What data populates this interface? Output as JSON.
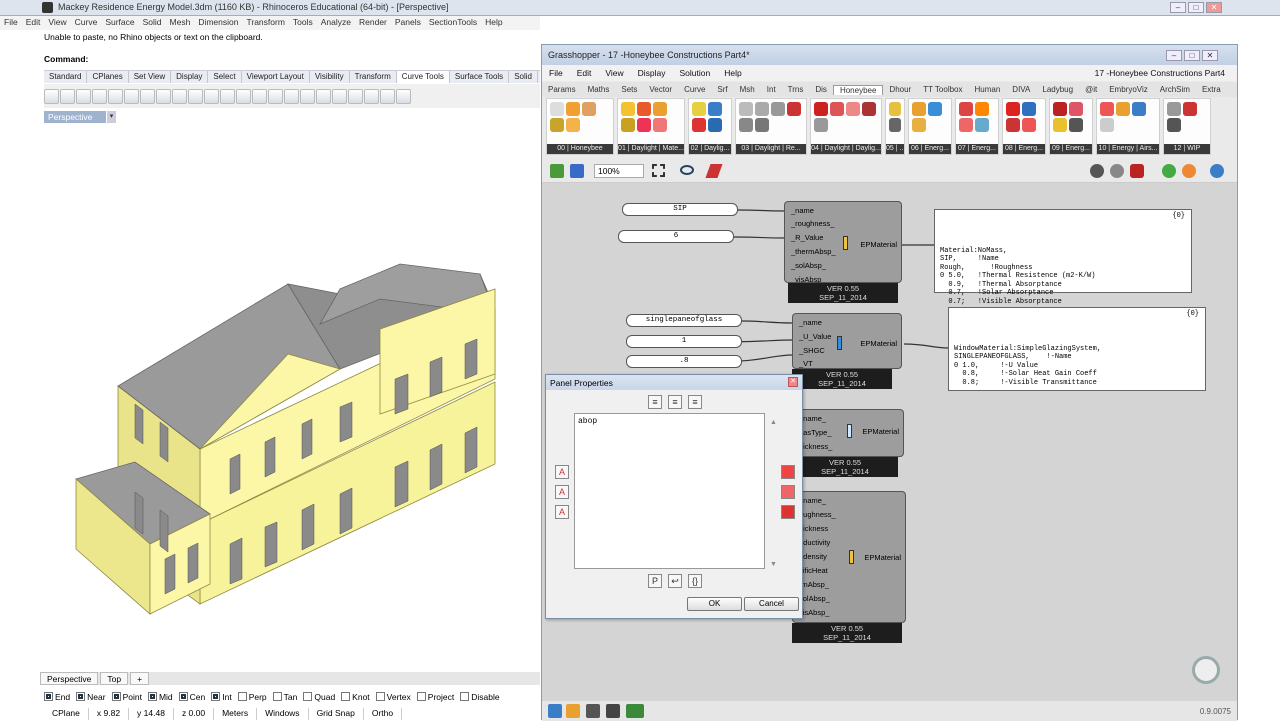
{
  "rhino": {
    "title": "Mackey Residence Energy Model.3dm (1160 KB) - Rhinoceros Educational (64-bit) - [Perspective]",
    "menu": [
      "File",
      "Edit",
      "View",
      "Curve",
      "Surface",
      "Solid",
      "Mesh",
      "Dimension",
      "Transform",
      "Tools",
      "Analyze",
      "Render",
      "Panels",
      "SectionTools",
      "Help"
    ],
    "command_history": "Unable to paste, no Rhino objects or text on the clipboard.",
    "command_prompt": "Command:",
    "toolbar_tabs": [
      "Standard",
      "CPlanes",
      "Set View",
      "Display",
      "Select",
      "Viewport Layout",
      "Visibility",
      "Transform",
      "Curve Tools",
      "Surface Tools",
      "Solid"
    ],
    "active_tab": "Curve Tools",
    "viewport_label": "Perspective",
    "viewport_tabs": [
      "Perspective",
      "Top",
      "+"
    ],
    "osnaps": [
      {
        "label": "End",
        "on": true
      },
      {
        "label": "Near",
        "on": true
      },
      {
        "label": "Point",
        "on": true
      },
      {
        "label": "Mid",
        "on": true
      },
      {
        "label": "Cen",
        "on": true
      },
      {
        "label": "Int",
        "on": true
      },
      {
        "label": "Perp",
        "on": false
      },
      {
        "label": "Tan",
        "on": false
      },
      {
        "label": "Quad",
        "on": false
      },
      {
        "label": "Knot",
        "on": false
      },
      {
        "label": "Vertex",
        "on": false
      },
      {
        "label": "Project",
        "on": false
      },
      {
        "label": "Disable",
        "on": false
      }
    ],
    "status": [
      "CPlane",
      "x 9.82",
      "y 14.48",
      "z 0.00",
      "Meters",
      "Windows",
      "Grid Snap",
      "Ortho"
    ]
  },
  "grasshopper": {
    "title": "Grasshopper - 17 -Honeybee Constructions Part4*",
    "menu": [
      "File",
      "Edit",
      "View",
      "Display",
      "Solution",
      "Help"
    ],
    "document": "17 -Honeybee Constructions Part4",
    "tabs": [
      "Params",
      "Maths",
      "Sets",
      "Vector",
      "Curve",
      "Srf",
      "Msh",
      "Int",
      "Trns",
      "Dis",
      "Honeybee",
      "Dhour",
      "TT Toolbox",
      "Human",
      "DIVA",
      "Ladybug",
      "@it",
      "EmbryoViz",
      "ArchSim",
      "Extra"
    ],
    "active_tab": "Honeybee",
    "ribbon_groups": [
      "00 | Honeybee",
      "01 | Daylight | Mate...",
      "02 | Daylig...",
      "03 | Daylight | Re...",
      "04 | Daylight | Daylig...",
      "05 | ...",
      "06 | Energ...",
      "07 | Energ...",
      "08 | Energ...",
      "09 | Energ...",
      "10 | Energy | Airs...",
      "12 | WIP"
    ],
    "zoom": "100%",
    "version": "0.9.0075",
    "inputs": {
      "sip": "SIP",
      "roughness_val": "6",
      "glass": "singlepaneofglass",
      "u_value": "1",
      "shgc": ".8"
    },
    "components": {
      "ep_material": "EPMaterial",
      "ver": "VER 0.55",
      "date": "SEP_11_2014",
      "c1_inputs": [
        "_name",
        "_roughness_",
        "_R_Value",
        "_thermAbsp_",
        "_solAbsp_",
        "_visAbsp_"
      ],
      "c2_inputs": [
        "_name",
        "_U_Value",
        "_SHGC",
        "_VT"
      ],
      "c3_inputs": [
        "_name_",
        "gasType_",
        "hickness_"
      ],
      "c4_inputs": [
        "_name_",
        "oughness_",
        "hickness",
        "nductivity",
        "_density",
        "cificHeat",
        "rmAbsp_",
        "solAbsp_",
        "visAbsp_"
      ]
    },
    "output_panel_1": {
      "index": "{0}",
      "text": "Material:NoMass,\nSIP,     !Name\nRough,      !Roughness\n0 5.0,   !Thermal Resistence (m2-K/W)\n  0.9,   !Thermal Absorptance\n  0.7,   !Solar Absorptance\n  0.7;   !Visible Absorptance"
    },
    "output_panel_2": {
      "index": "{0}",
      "text": "WindowMaterial:SimpleGlazingSystem,\nSINGLEPANEOFGLASS,    !-Name\n0 1.0,     !-U Value\n  0.8,     !-Solar Heat Gain Coeff\n  0.8;     !-Visible Transmittance"
    }
  },
  "dialog": {
    "title": "Panel Properties",
    "text": "abop",
    "ok": "OK",
    "cancel": "Cancel"
  },
  "colors": {
    "wall": "#fbf7a6",
    "roof": "#9a9a9a",
    "window": "#8a8a8a",
    "canvas": "#d4d4d4",
    "component": "#9d9d9d"
  }
}
